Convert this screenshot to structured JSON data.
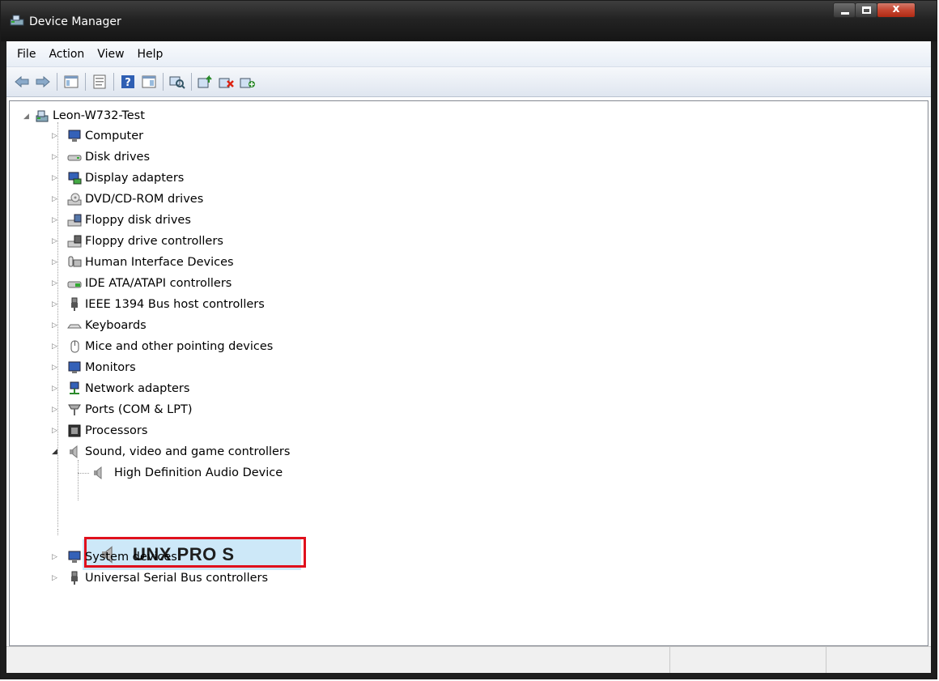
{
  "window": {
    "title": "Device Manager"
  },
  "menubar": {
    "items": [
      "File",
      "Action",
      "View",
      "Help"
    ]
  },
  "toolbar": {
    "buttons": [
      "back-icon",
      "forward-icon",
      "console-tree-icon",
      "properties-icon",
      "help-icon",
      "view-icon",
      "scan-hardware-icon",
      "update-driver-icon",
      "uninstall-icon",
      "enable-device-icon"
    ]
  },
  "tree": {
    "root": "Leon-W732-Test",
    "categories": [
      "Computer",
      "Disk drives",
      "Display adapters",
      "DVD/CD-ROM drives",
      "Floppy disk drives",
      "Floppy drive controllers",
      "Human Interface Devices",
      "IDE ATA/ATAPI controllers",
      "IEEE 1394 Bus host controllers",
      "Keyboards",
      "Mice and other pointing devices",
      "Monitors",
      "Network adapters",
      "Ports (COM & LPT)",
      "Processors",
      "Sound, video and game controllers"
    ],
    "sound_children": [
      "High Definition Audio Device",
      "UNX PRO S"
    ],
    "after": [
      "System devices",
      "Universal Serial Bus controllers"
    ]
  },
  "colors": {
    "highlight": "#e0101c",
    "selection": "#cde8f8"
  }
}
